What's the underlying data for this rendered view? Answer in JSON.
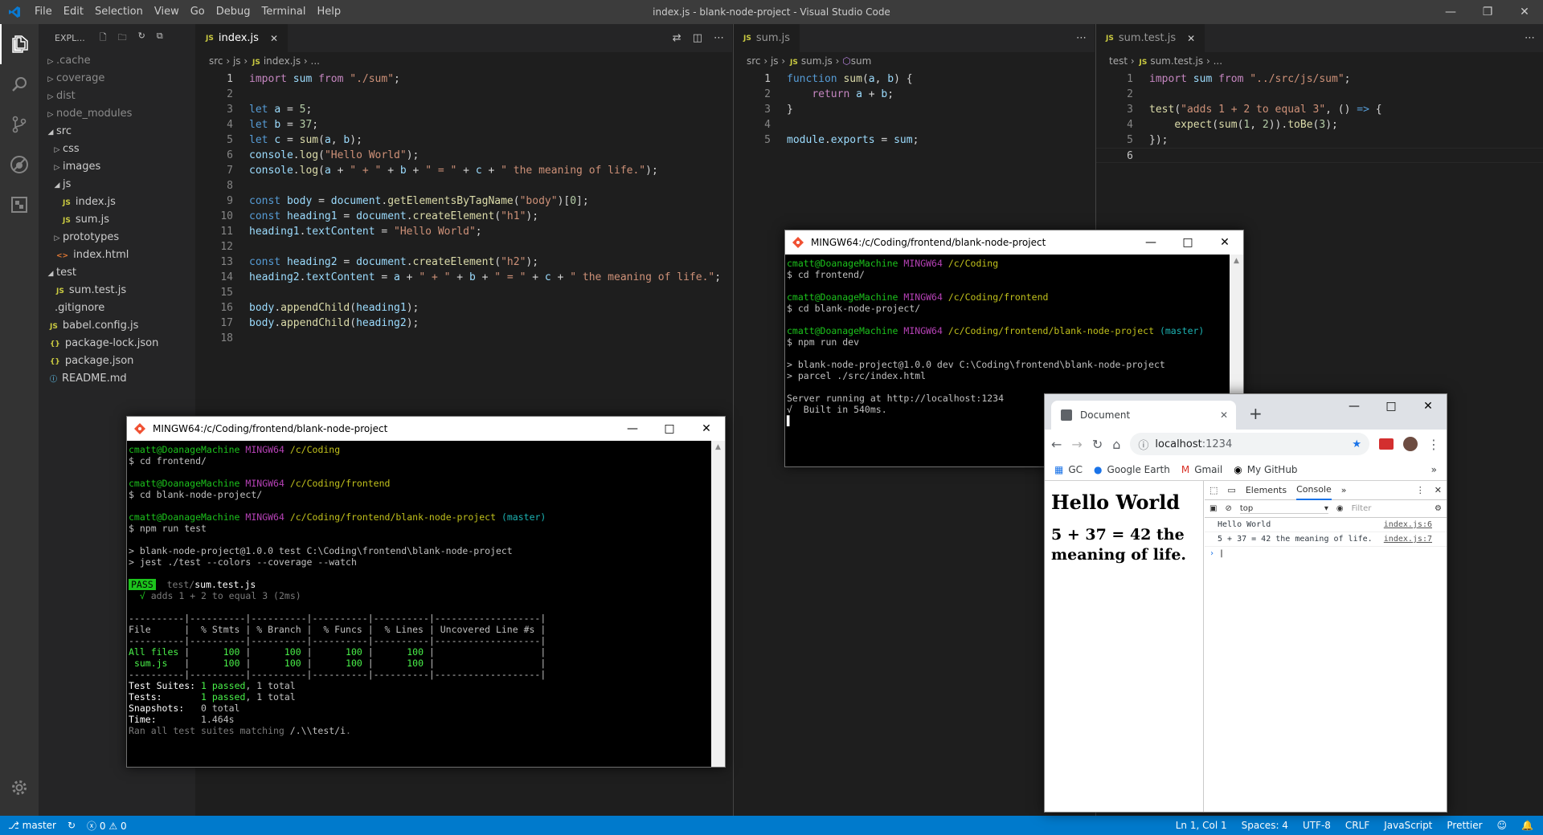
{
  "titlebar": {
    "menu": [
      "File",
      "Edit",
      "Selection",
      "View",
      "Go",
      "Debug",
      "Terminal",
      "Help"
    ],
    "title": "index.js - blank-node-project - Visual Studio Code"
  },
  "explorer": {
    "header": "EXPL...",
    "items": [
      {
        "label": ".cache",
        "kind": "folder-closed",
        "level": 0,
        "gray": true
      },
      {
        "label": "coverage",
        "kind": "folder-closed",
        "level": 0,
        "gray": true
      },
      {
        "label": "dist",
        "kind": "folder-closed",
        "level": 0,
        "gray": true
      },
      {
        "label": "node_modules",
        "kind": "folder-closed",
        "level": 0,
        "gray": true
      },
      {
        "label": "src",
        "kind": "folder-open",
        "level": 0
      },
      {
        "label": "css",
        "kind": "folder-closed",
        "level": 1
      },
      {
        "label": "images",
        "kind": "folder-closed",
        "level": 1
      },
      {
        "label": "js",
        "kind": "folder-open",
        "level": 1
      },
      {
        "label": "index.js",
        "kind": "js",
        "level": 2
      },
      {
        "label": "sum.js",
        "kind": "js",
        "level": 2
      },
      {
        "label": "prototypes",
        "kind": "folder-closed",
        "level": 1
      },
      {
        "label": "index.html",
        "kind": "html",
        "level": 1
      },
      {
        "label": "test",
        "kind": "folder-open",
        "level": 0
      },
      {
        "label": "sum.test.js",
        "kind": "js",
        "level": 1
      },
      {
        "label": ".gitignore",
        "kind": "git",
        "level": 0
      },
      {
        "label": "babel.config.js",
        "kind": "js",
        "level": 0
      },
      {
        "label": "package-lock.json",
        "kind": "json",
        "level": 0
      },
      {
        "label": "package.json",
        "kind": "json",
        "level": 0
      },
      {
        "label": "README.md",
        "kind": "info",
        "level": 0
      }
    ]
  },
  "editors": {
    "index": {
      "tab": "index.js",
      "crumbs": [
        "src",
        "js",
        "index.js",
        "..."
      ]
    },
    "sum": {
      "tab": "sum.js",
      "crumbs": [
        "src",
        "js",
        "sum.js",
        "sum"
      ]
    },
    "sumtest": {
      "tab": "sum.test.js",
      "crumbs": [
        "test",
        "sum.test.js",
        "..."
      ]
    }
  },
  "statusbar": {
    "branch": "master",
    "errors": "0",
    "warnings": "0",
    "position": "Ln 1, Col 1",
    "spaces": "Spaces: 4",
    "encoding": "UTF-8",
    "eol": "CRLF",
    "language": "JavaScript",
    "formatter": "Prettier"
  },
  "terminal_dev": {
    "title": "MINGW64:/c/Coding/frontend/blank-node-project"
  },
  "terminal_test": {
    "title": "MINGW64:/c/Coding/frontend/blank-node-project"
  },
  "browser": {
    "tab_title": "Document",
    "url_host": "localhost",
    "url_port": ":1234",
    "bookmarks": [
      "GC",
      "Google Earth",
      "Gmail",
      "My GitHub"
    ],
    "page_h1": "Hello World",
    "page_h2": "5 + 37 = 42 the meaning of life.",
    "devtools_tabs": [
      "Elements",
      "Console"
    ],
    "context": "top",
    "filter_placeholder": "Filter",
    "console": [
      {
        "msg": "Hello World",
        "src": "index.js:6"
      },
      {
        "msg": "5 + 37 = 42 the meaning of life.",
        "src": "index.js:7"
      }
    ]
  }
}
